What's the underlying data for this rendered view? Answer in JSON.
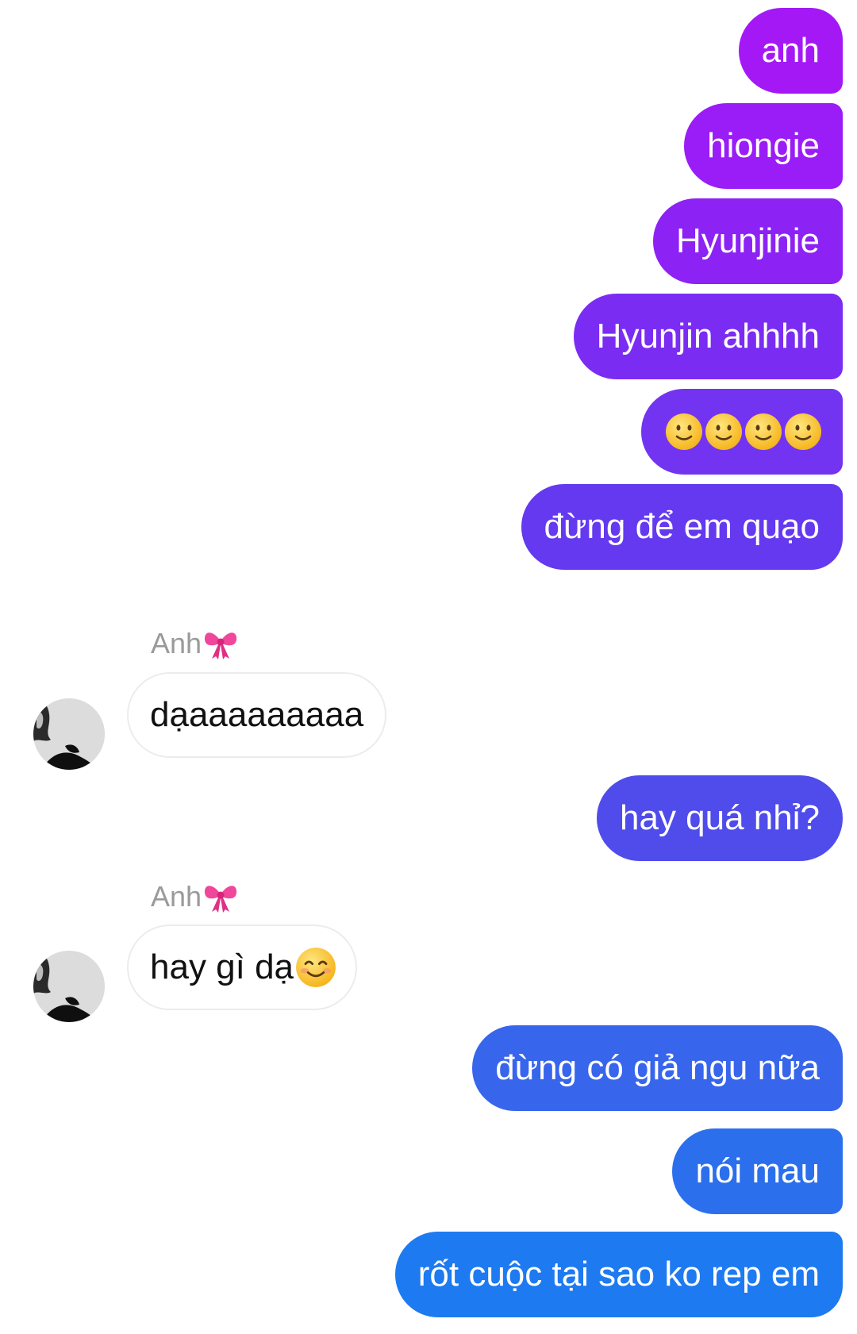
{
  "conversation": {
    "outgoing_1": [
      "anh",
      "hiongie",
      "Hyunjinie",
      "Hyunjin ahhhh",
      "🙂🙂🙂🙂",
      "đừng để em quạo"
    ],
    "incoming_1": {
      "sender": "Anh🎀",
      "text": "dạaaaaaaaaa"
    },
    "outgoing_2": [
      "hay quá nhỉ?"
    ],
    "incoming_2": {
      "sender": "Anh🎀",
      "text_prefix": "hay gì dạ",
      "emoji": "😊"
    },
    "outgoing_3": [
      "đừng có giả ngu nữa",
      "nói mau",
      "rốt cuộc tại sao ko rep em"
    ]
  },
  "colors": {
    "gradient_top": "#a517f5",
    "gradient_mid": "#5a43ee",
    "gradient_bottom": "#1e7af0",
    "incoming_bubble": "#ffffff",
    "incoming_border": "#ececec",
    "sender_label": "#9a9a9a"
  },
  "icons": {
    "slightly_smiling_face": "slightly-smiling-face-icon",
    "smiling_face_with_smiling_eyes": "smiling-face-icon",
    "ribbon": "ribbon-icon"
  }
}
